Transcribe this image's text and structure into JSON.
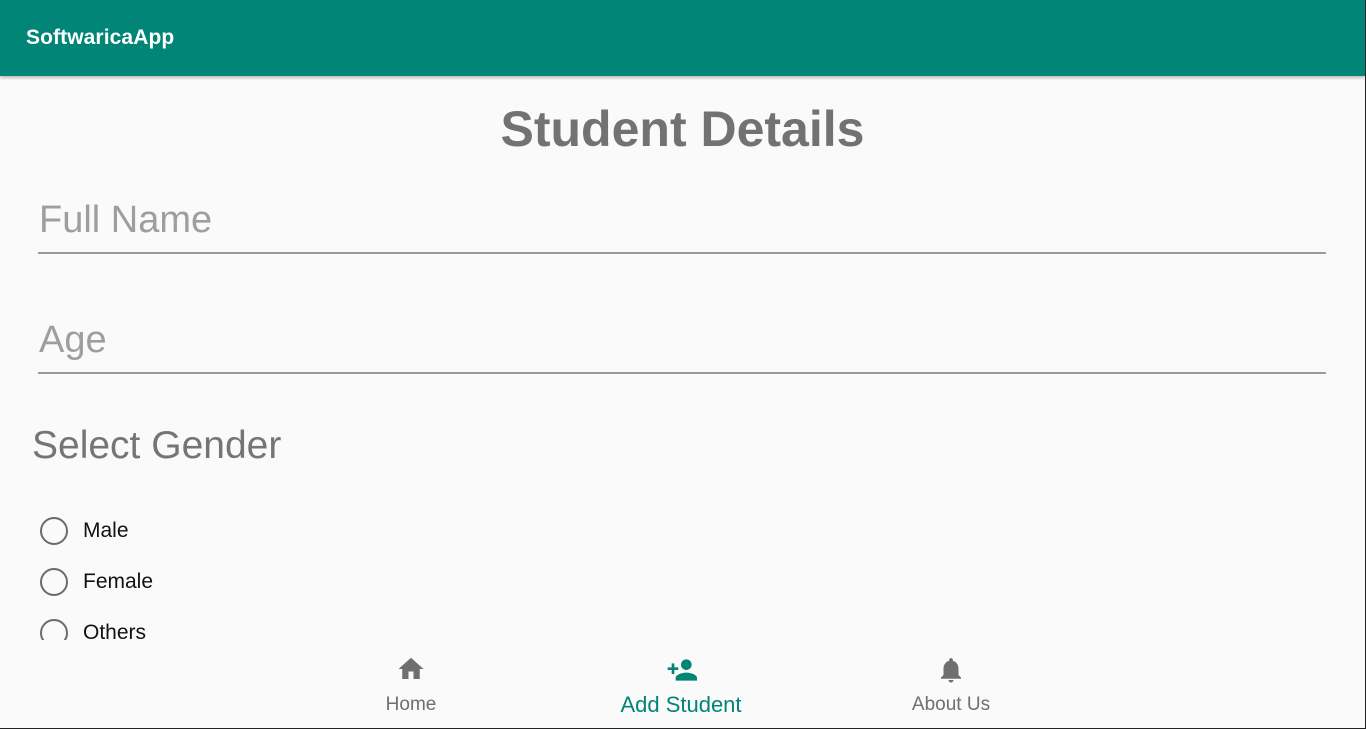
{
  "app": {
    "title": "SoftwaricaApp",
    "accent": "#018577"
  },
  "main": {
    "title": "Student Details",
    "full_name": {
      "value": "",
      "placeholder": "Full Name"
    },
    "age": {
      "value": "",
      "placeholder": "Age"
    },
    "gender": {
      "label": "Select Gender",
      "options": [
        "Male",
        "Female",
        "Others"
      ],
      "selected": null
    }
  },
  "bottom_nav": {
    "items": [
      {
        "label": "Home",
        "icon": "home-icon",
        "active": false
      },
      {
        "label": "Add Student",
        "icon": "add-person-icon",
        "active": true
      },
      {
        "label": "About Us",
        "icon": "bell-icon",
        "active": false
      }
    ]
  }
}
